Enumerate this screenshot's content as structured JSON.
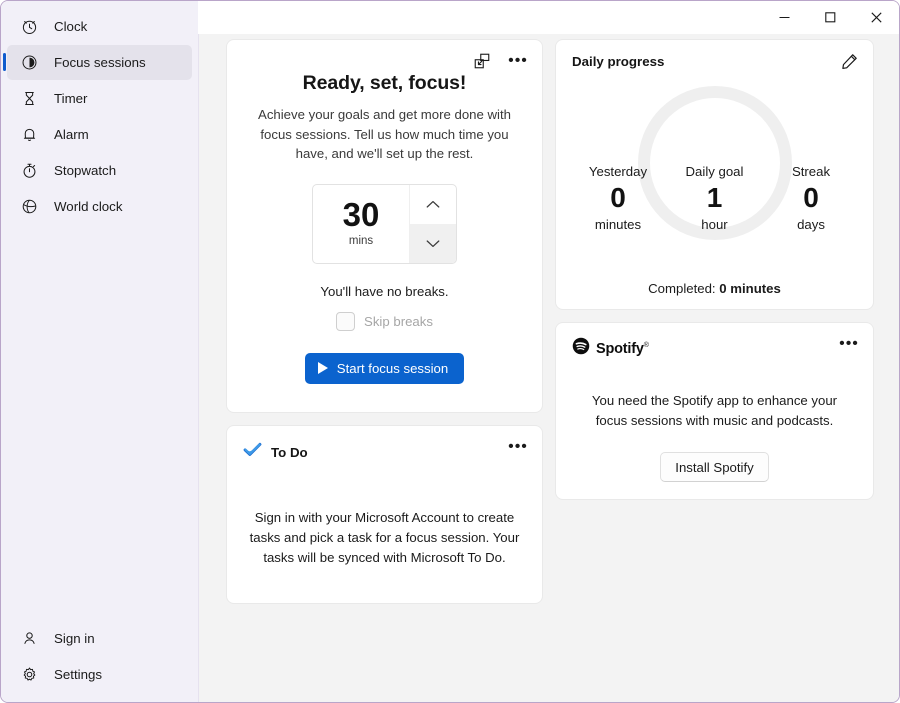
{
  "window": {
    "app_title": "Clock",
    "accent_color": "#0f5ccd",
    "border_color": "#b9a5c9",
    "controls": {
      "minimize": "Minimize",
      "maximize": "Maximize",
      "close": "Close"
    }
  },
  "sidebar": {
    "items": [
      {
        "label": "Clock",
        "icon": "clock-icon",
        "selected": false
      },
      {
        "label": "Focus sessions",
        "icon": "focus-sessions-icon",
        "selected": true
      },
      {
        "label": "Timer",
        "icon": "hourglass-icon",
        "selected": false
      },
      {
        "label": "Alarm",
        "icon": "bell-icon",
        "selected": false
      },
      {
        "label": "Stopwatch",
        "icon": "stopwatch-icon",
        "selected": false
      },
      {
        "label": "World clock",
        "icon": "globe-icon",
        "selected": false
      }
    ],
    "bottom_items": [
      {
        "label": "Sign in",
        "icon": "person-icon"
      },
      {
        "label": "Settings",
        "icon": "gear-icon"
      }
    ]
  },
  "focus_card": {
    "popout_icon": "pop-out-icon",
    "more_icon": "more-options-icon",
    "title": "Ready, set, focus!",
    "description": "Achieve your goals and get more done with focus sessions. Tell us how much time you have, and we'll set up the rest.",
    "spinner": {
      "value": "30",
      "unit": "mins",
      "increment_icon": "chevron-up-icon",
      "decrement_icon": "chevron-down-icon"
    },
    "breaks_text": "You'll have no breaks.",
    "skip_breaks_label": "Skip breaks",
    "skip_breaks_checked": false,
    "start_button_label": "Start focus session",
    "start_button_color": "#0b63ce",
    "play_icon": "play-icon"
  },
  "todo_card": {
    "icon": "todo-check-icon",
    "icon_color": "#2c7cd6",
    "title": "To Do",
    "more_icon": "more-options-icon",
    "body": "Sign in with your Microsoft Account to create tasks and pick a task for a focus session. Your tasks will be synced with Microsoft To Do."
  },
  "progress_card": {
    "title": "Daily progress",
    "edit_icon": "pencil-icon",
    "ring_color": "#efefef",
    "yesterday": {
      "label": "Yesterday",
      "value": "0",
      "unit": "minutes"
    },
    "daily_goal": {
      "label": "Daily goal",
      "value": "1",
      "unit": "hour"
    },
    "streak": {
      "label": "Streak",
      "value": "0",
      "unit": "days"
    },
    "completed_prefix": "Completed: ",
    "completed_value": "0 minutes"
  },
  "spotify_card": {
    "logo_icon": "spotify-icon",
    "brand": "Spotify",
    "more_icon": "more-options-icon",
    "body": "You need the Spotify app to enhance your focus sessions with music and podcasts.",
    "install_button_label": "Install Spotify"
  }
}
